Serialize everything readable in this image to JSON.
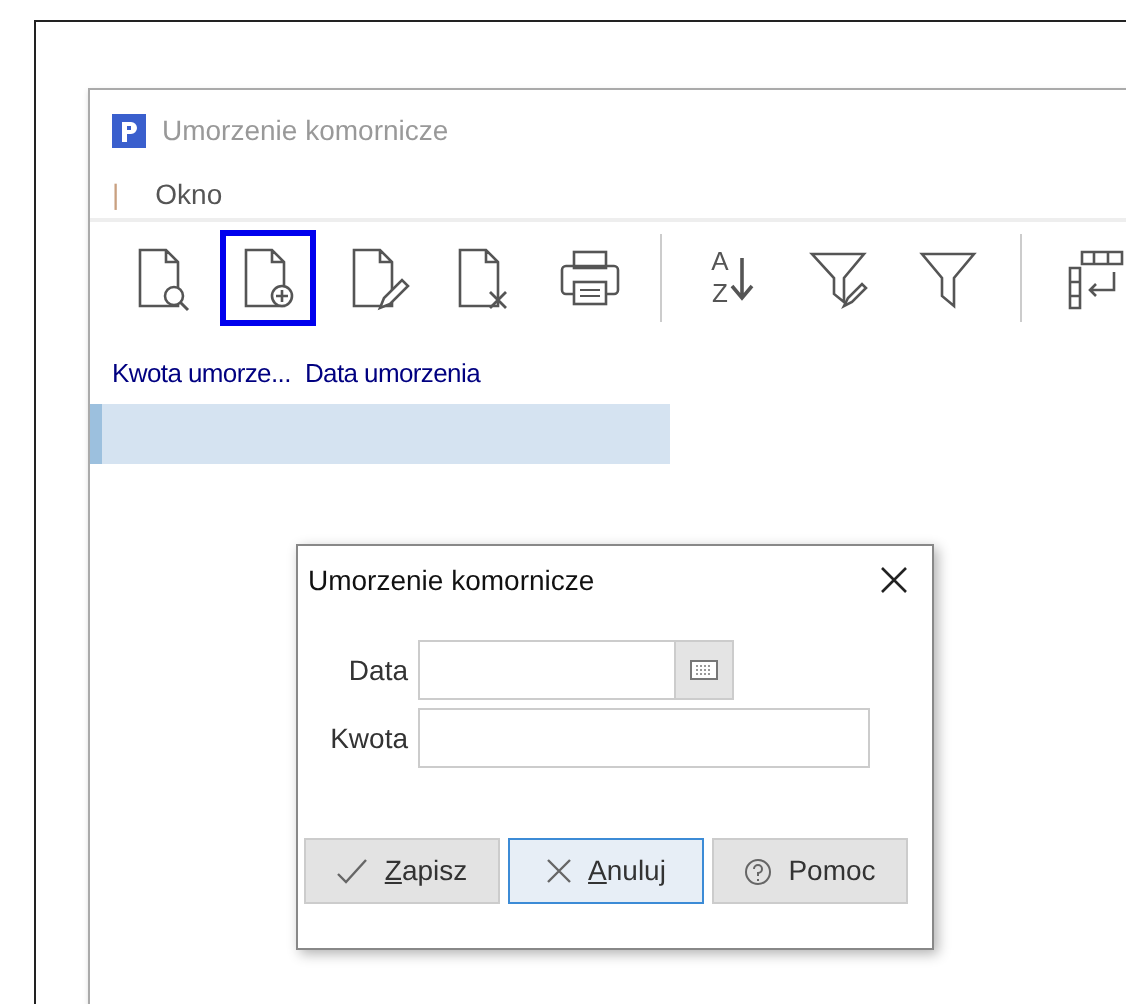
{
  "window": {
    "title": "Umorzenie komornicze"
  },
  "menu": [
    {
      "label": "|"
    },
    {
      "label": "Okno"
    }
  ],
  "toolbar": [
    {
      "kind": "preview",
      "selected": false
    },
    {
      "kind": "add",
      "selected": true
    },
    {
      "kind": "edit",
      "selected": false
    },
    {
      "kind": "delete",
      "selected": false
    },
    {
      "kind": "print",
      "selected": false
    },
    {
      "kind": "separator"
    },
    {
      "kind": "sort",
      "label_top": "A",
      "label_bottom": "Z",
      "selected": false
    },
    {
      "kind": "filter-edit",
      "selected": false
    },
    {
      "kind": "filter",
      "selected": false
    },
    {
      "kind": "separator"
    },
    {
      "kind": "columns",
      "selected": false
    }
  ],
  "table": {
    "columns": [
      "Kwota umorze...",
      "Data umorzenia"
    ],
    "rows": [
      {
        "selected": true
      }
    ]
  },
  "dialog": {
    "title": "Umorzenie komornicze",
    "fields": [
      {
        "label": "Data",
        "kind": "date"
      },
      {
        "label": "Kwota",
        "kind": "text"
      }
    ],
    "buttons": [
      {
        "label": "Zapisz",
        "kind": "save",
        "mnemonic": true,
        "focused": false
      },
      {
        "label": "Anuluj",
        "kind": "cancel",
        "mnemonic": true,
        "focused": true
      },
      {
        "label": "Pomoc",
        "kind": "help",
        "mnemonic": false,
        "focused": false
      }
    ]
  }
}
